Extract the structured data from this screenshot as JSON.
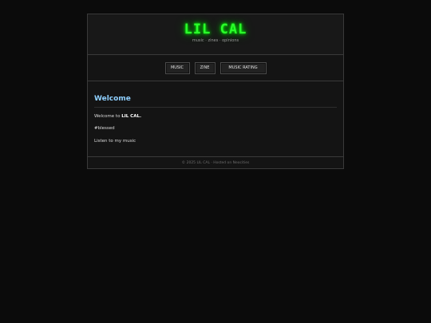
{
  "header": {
    "title": "LIL CAL",
    "tagline": "music · zines · opinions"
  },
  "nav": {
    "items": [
      {
        "label": "MUSIC"
      },
      {
        "label": "ZINE"
      },
      {
        "label": "MUSIC RATING"
      }
    ]
  },
  "main": {
    "heading": "Welcome",
    "welcome_prefix": "Welcome to ",
    "welcome_name": "LIL CAL.",
    "line2": "#blessed",
    "line3": "Listen to my music"
  },
  "footer": {
    "text": "© 2025 LIL CAL · Hosted on Neocities"
  },
  "colors": {
    "background": "#0b0b0b",
    "title_glow": "#2bff2b",
    "heading": "#8fd0ff"
  }
}
